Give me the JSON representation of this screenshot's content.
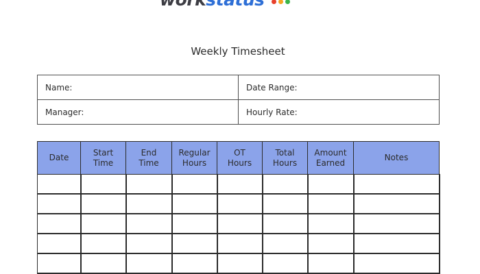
{
  "logo": {
    "part1": "work",
    "part2": "status",
    "dots": [
      "#e8412c",
      "#f5a623",
      "#3ab54a"
    ]
  },
  "title": "Weekly Timesheet",
  "info": {
    "name_label": "Name:",
    "date_range_label": "Date Range:",
    "manager_label": "Manager:",
    "hourly_rate_label": "Hourly Rate:"
  },
  "table": {
    "header_color": "#8ba3ea",
    "columns": [
      {
        "key": "date",
        "lines": [
          "Date"
        ]
      },
      {
        "key": "start-time",
        "lines": [
          "Start",
          "Time"
        ]
      },
      {
        "key": "end-time",
        "lines": [
          "End",
          "Time"
        ]
      },
      {
        "key": "regular-hours",
        "lines": [
          "Regular",
          "Hours"
        ]
      },
      {
        "key": "ot-hours",
        "lines": [
          "OT",
          "Hours"
        ]
      },
      {
        "key": "total-hours",
        "lines": [
          "Total",
          "Hours"
        ]
      },
      {
        "key": "amount-earned",
        "lines": [
          "Amount",
          "Earned"
        ]
      },
      {
        "key": "notes",
        "lines": [
          "Notes"
        ]
      }
    ],
    "visible_rows": 5
  }
}
